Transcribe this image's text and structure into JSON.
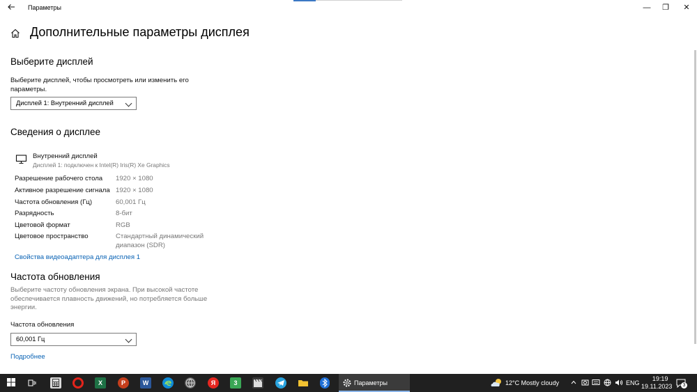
{
  "window": {
    "title": "Параметры",
    "minimize_glyph": "—",
    "maximize_glyph": "❐",
    "close_glyph": "✕"
  },
  "page": {
    "title": "Дополнительные параметры дисплея"
  },
  "select_display": {
    "heading": "Выберите дисплей",
    "description_line1": "Выберите дисплей, чтобы просмотреть или изменить его",
    "description_line2": "параметры.",
    "dropdown_value": "Дисплей 1: Внутренний дисплей"
  },
  "display_info": {
    "heading": "Сведения о дисплее",
    "monitor_name": "Внутренний дисплей",
    "monitor_subtitle": "Дисплей 1: подключен к Intel(R) Iris(R) Xe Graphics",
    "rows": [
      {
        "label": "Разрешение рабочего стола",
        "value": "1920 × 1080"
      },
      {
        "label": "Активное разрешение сигнала",
        "value": "1920 × 1080"
      },
      {
        "label": "Частота обновления (Гц)",
        "value": "60,001 Гц"
      },
      {
        "label": "Разрядность",
        "value": "8-бит"
      },
      {
        "label": "Цветовой формат",
        "value": "RGB"
      },
      {
        "label": "Цветовое пространство",
        "value": "Стандартный динамический",
        "value2": "диапазон (SDR)"
      }
    ],
    "adapter_link": "Свойства видеоадаптера для дисплея 1"
  },
  "refresh": {
    "heading": "Частота обновления",
    "description_line1": "Выберите частоту обновления экрана. При высокой частоте",
    "description_line2": "обеспечивается плавность движений, но потребляется больше",
    "description_line3": "энергии.",
    "field_label": "Частота обновления",
    "dropdown_value": "60,001 Гц",
    "more_link": "Подробнее"
  },
  "taskbar": {
    "active_app_label": "Параметры",
    "excel_letter": "X",
    "powerpoint_letter": "P",
    "word_letter": "W",
    "yandex_letter": "Я",
    "app3_letter": "3",
    "weather": "12°C  Mostly cloudy",
    "lang": "ENG",
    "time": "19:19",
    "date": "19.11.2023",
    "notification_count": "3"
  },
  "colors": {
    "accent": "#0a63b5",
    "taskbar": "#202020",
    "opera": "#e3241b",
    "excel": "#1e7145",
    "powerpoint": "#c43e1c",
    "word": "#2b579a",
    "edge": "#0f8bd6",
    "yandex": "#e52620",
    "telegram": "#2aa3de",
    "explorer": "#f2c232",
    "bluetooth": "#1f6fd6"
  }
}
